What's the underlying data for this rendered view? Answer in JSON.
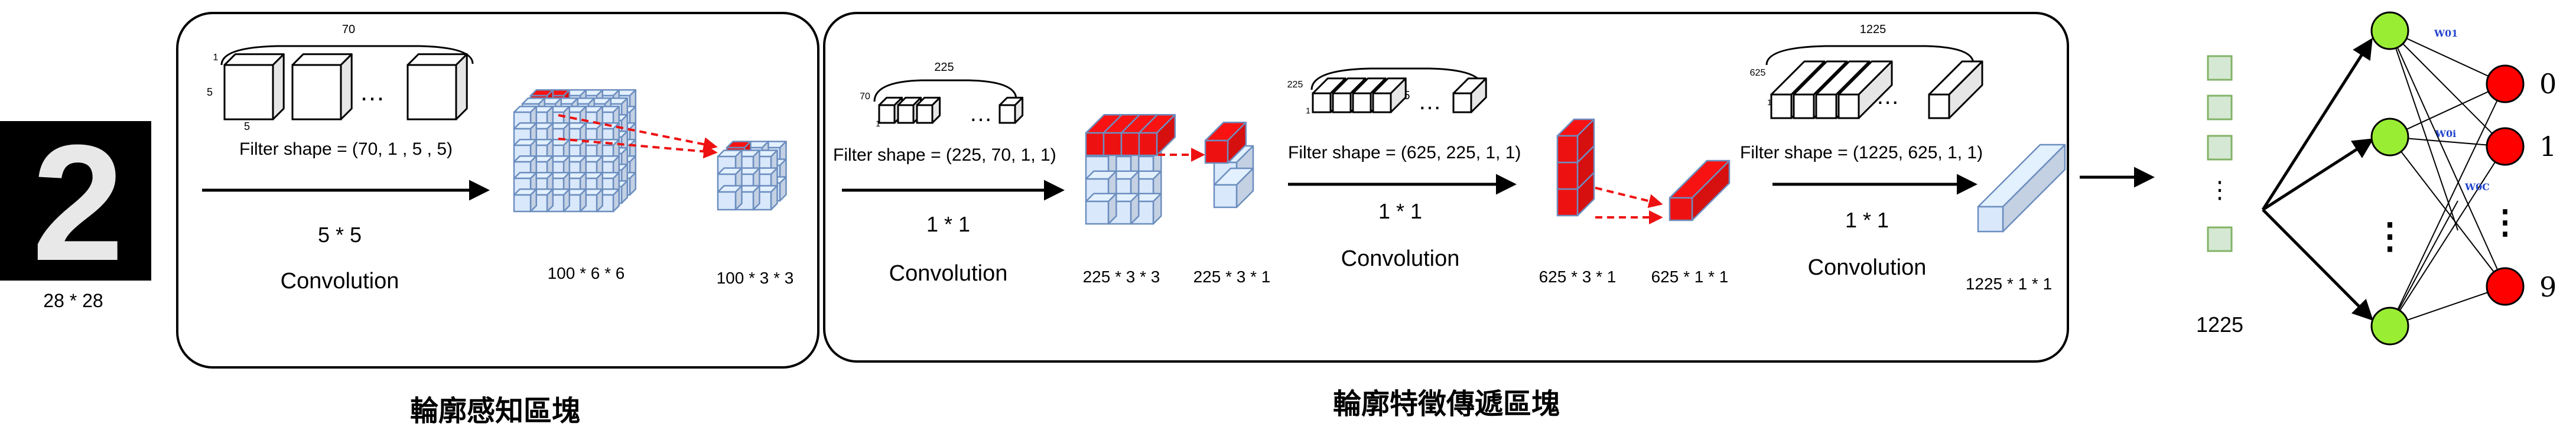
{
  "input": {
    "digit_glyph": "2",
    "size_label": "28 * 28"
  },
  "block1": {
    "title": "輪廓感知區塊",
    "filter_count": "70",
    "filter_dim_top": "1",
    "filter_dim_side": "5",
    "filter_dim_bottom": "5",
    "ellipsis": "…",
    "filter_shape": "Filter shape = (70, 1 , 5 , 5)",
    "kernel_label": "5 * 5",
    "op_label": "Convolution",
    "output_label": "100 * 6 * 6",
    "pooled_label": "100 * 3 * 3"
  },
  "block2": {
    "title": "輪廓特徵傳遞區塊",
    "stage1": {
      "filter_count": "225",
      "dim_a": "70",
      "dim_b": "1",
      "ellipsis": "…",
      "filter_shape": "Filter shape = (225, 70, 1, 1)",
      "kernel_label": "1 * 1",
      "op_label": "Convolution",
      "output_label": "225 * 3 * 3",
      "pooled_label": "225 * 3 * 1"
    },
    "stage2": {
      "filter_count": "625",
      "dim_a": "225",
      "dim_b": "1",
      "ellipsis": "…",
      "filter_shape": "Filter shape = (625, 225, 1, 1)",
      "kernel_label": "1 * 1",
      "op_label": "Convolution",
      "output_label": "625 * 3 * 1",
      "pooled_label": "625 * 1 * 1"
    },
    "stage3": {
      "filter_count": "1225",
      "dim_a": "625",
      "dim_b": "1",
      "ellipsis": "…",
      "filter_shape": "Filter shape = (1225, 625, 1, 1)",
      "kernel_label": "1 * 1",
      "op_label": "Convolution",
      "output_label": "1225 * 1 * 1"
    }
  },
  "flatten": {
    "ellipsis": "⋮",
    "count_label": "1225"
  },
  "classifier": {
    "weight_labels": [
      "W01",
      "W0i",
      "W0C"
    ],
    "vdots": "⋮",
    "outputs": [
      "0",
      "1",
      "9"
    ]
  },
  "colors": {
    "cube_fill": "#dae8fc",
    "cube_stroke": "#6c8ebf",
    "highlight": "#ee1111",
    "flatten_fill": "#d5e8d4",
    "flatten_stroke": "#82b366",
    "hidden_node": "#99ee33",
    "output_node": "#ff0000",
    "weight_text": "#2244cc"
  }
}
